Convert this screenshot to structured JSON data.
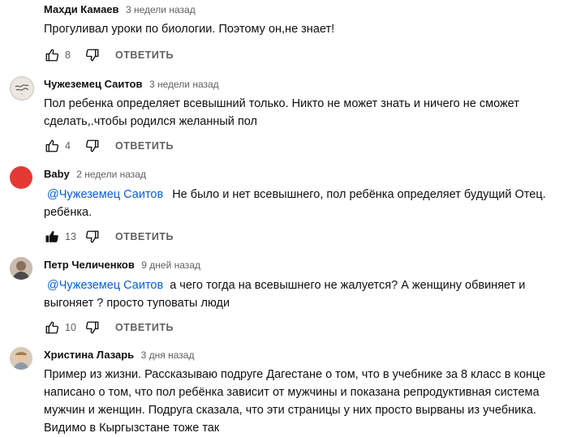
{
  "reply_label": "ОТВЕТИТЬ",
  "colors": {
    "mention": "#065fd4",
    "avatar_baby": "#e53935"
  },
  "comments": [
    {
      "author": "Махди Камаев",
      "time": "3 недели назад",
      "text_lines": [
        "Прогуливал уроки по биологии. Поэтому он,не знает!"
      ],
      "likes": "8"
    },
    {
      "author": "Чужеземец Саитов",
      "time": "3 недели назад",
      "text_lines": [
        "Пол ребенка определяет всевышний только. Никто не может знать и ничего не сможет",
        "сделать,.чтобы родился желанный пол"
      ],
      "likes": "4"
    },
    {
      "author": "Baby",
      "time": "2 недели назад",
      "mention": "@Чужеземец Саитов",
      "text_lines": [
        "Не было и нет всевышнего, пол ребёнка определяет будущий Отец.",
        "ребёнка."
      ],
      "likes": "13"
    },
    {
      "author": "Петр Челиченков",
      "time": "9 дней назад",
      "mention": "@Чужеземец Саитов",
      "text_lines": [
        "а чего тогда на всевышнего не жалуется? А женщину обвиняет и",
        "выгоняет ? просто туповаты люди"
      ],
      "likes": "10"
    },
    {
      "author": "Христина Лазарь",
      "time": "3 дня назад",
      "text_lines": [
        "Пример из жизни. Рассказываю подруге Дагестане о том, что в учебнике за 8 класс в конце",
        "написано о том, что пол ребёнка зависит от мужчины и показана репродуктивная система",
        "мужчин и женщин. Подруга сказала, что эти страницы у них просто вырваны из учебника.",
        "Видимо в Кыргызстане тоже так"
      ]
    }
  ]
}
